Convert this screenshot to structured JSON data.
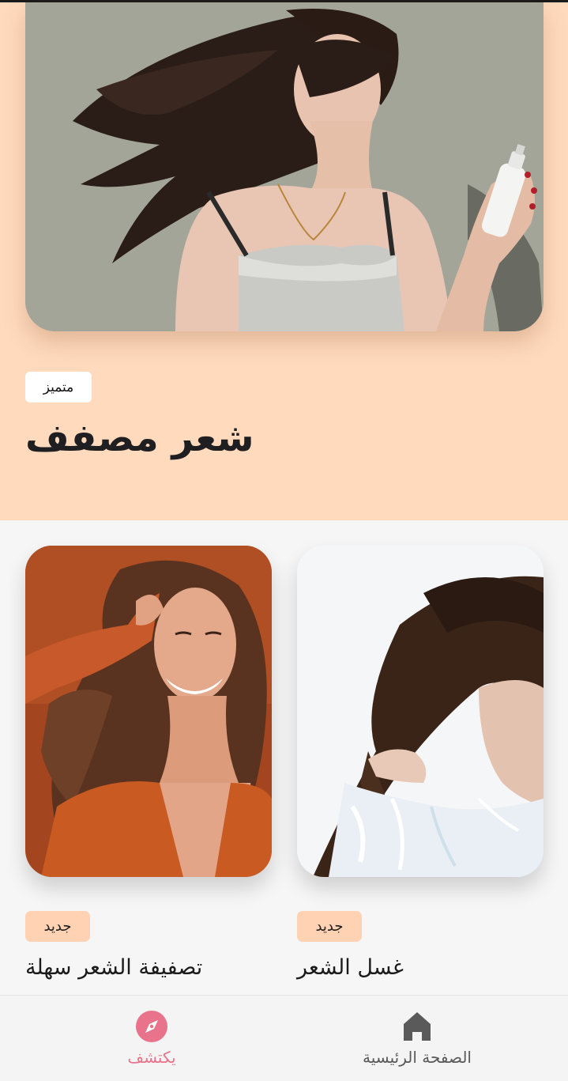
{
  "hero": {
    "badge": "متميز",
    "title": "شعر مصفف",
    "image": "woman-hair-spray-photo"
  },
  "cards": [
    {
      "badge": "جديد",
      "title": "غسل الشعر",
      "image": "hair-washing-photo"
    },
    {
      "badge": "جديد",
      "title": "تصفيفة الشعر سهلة",
      "image": "smiling-woman-long-hair-photo"
    }
  ],
  "nav": {
    "items": [
      {
        "label": "الصفحة الرئيسية",
        "icon": "home-icon",
        "active": false
      },
      {
        "label": "يكتشف",
        "icon": "compass-icon",
        "active": true
      }
    ],
    "active_color": "#e8738a",
    "inactive_color": "#5a5a5a"
  },
  "colors": {
    "hero_bg": "#ffdabd",
    "badge_new_bg": "#ffd2b3",
    "page_bg": "#f6f6f6"
  }
}
